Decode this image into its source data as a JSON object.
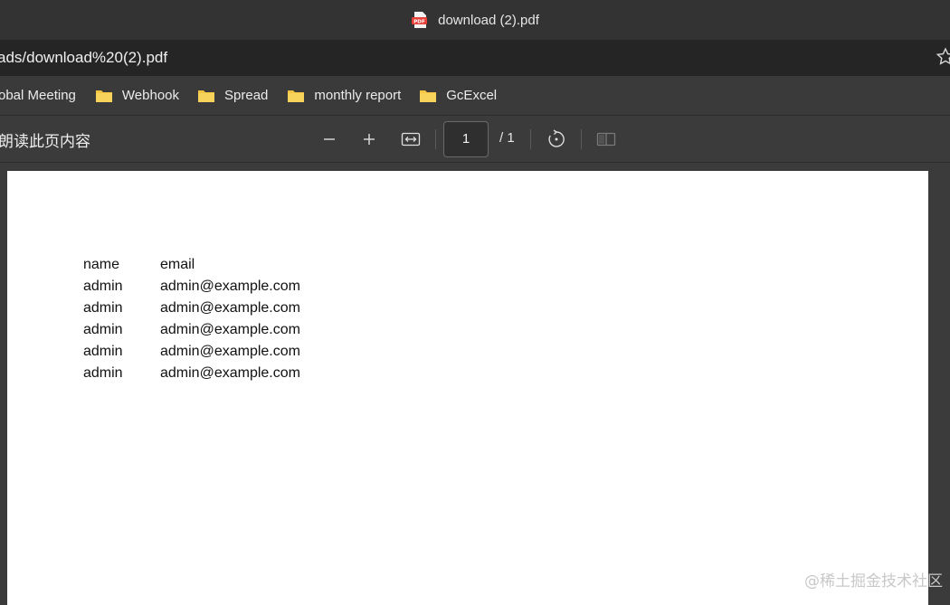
{
  "window": {
    "title": "download (2).pdf",
    "icon": "pdf-icon"
  },
  "address_bar": {
    "url": "ads/download%20(2).pdf"
  },
  "bookmarks": [
    {
      "label": "obal Meeting",
      "icon": "none"
    },
    {
      "label": "Webhook",
      "icon": "folder-icon"
    },
    {
      "label": "Spread",
      "icon": "folder-icon"
    },
    {
      "label": "monthly report",
      "icon": "folder-icon"
    },
    {
      "label": "GcExcel",
      "icon": "folder-icon"
    }
  ],
  "pdf_toolbar": {
    "read_aloud_label": "朗读此页内容",
    "current_page": "1",
    "total_pages": "/ 1"
  },
  "pdf_content": {
    "headers": [
      "name",
      "email"
    ],
    "rows": [
      [
        "admin",
        "admin@example.com"
      ],
      [
        "admin",
        "admin@example.com"
      ],
      [
        "admin",
        "admin@example.com"
      ],
      [
        "admin",
        "admin@example.com"
      ],
      [
        "admin",
        "admin@example.com"
      ]
    ]
  },
  "watermark": "@稀土掘金技术社区",
  "colors": {
    "folder": "#f5c542",
    "pdf_badge": "#e8413a"
  }
}
